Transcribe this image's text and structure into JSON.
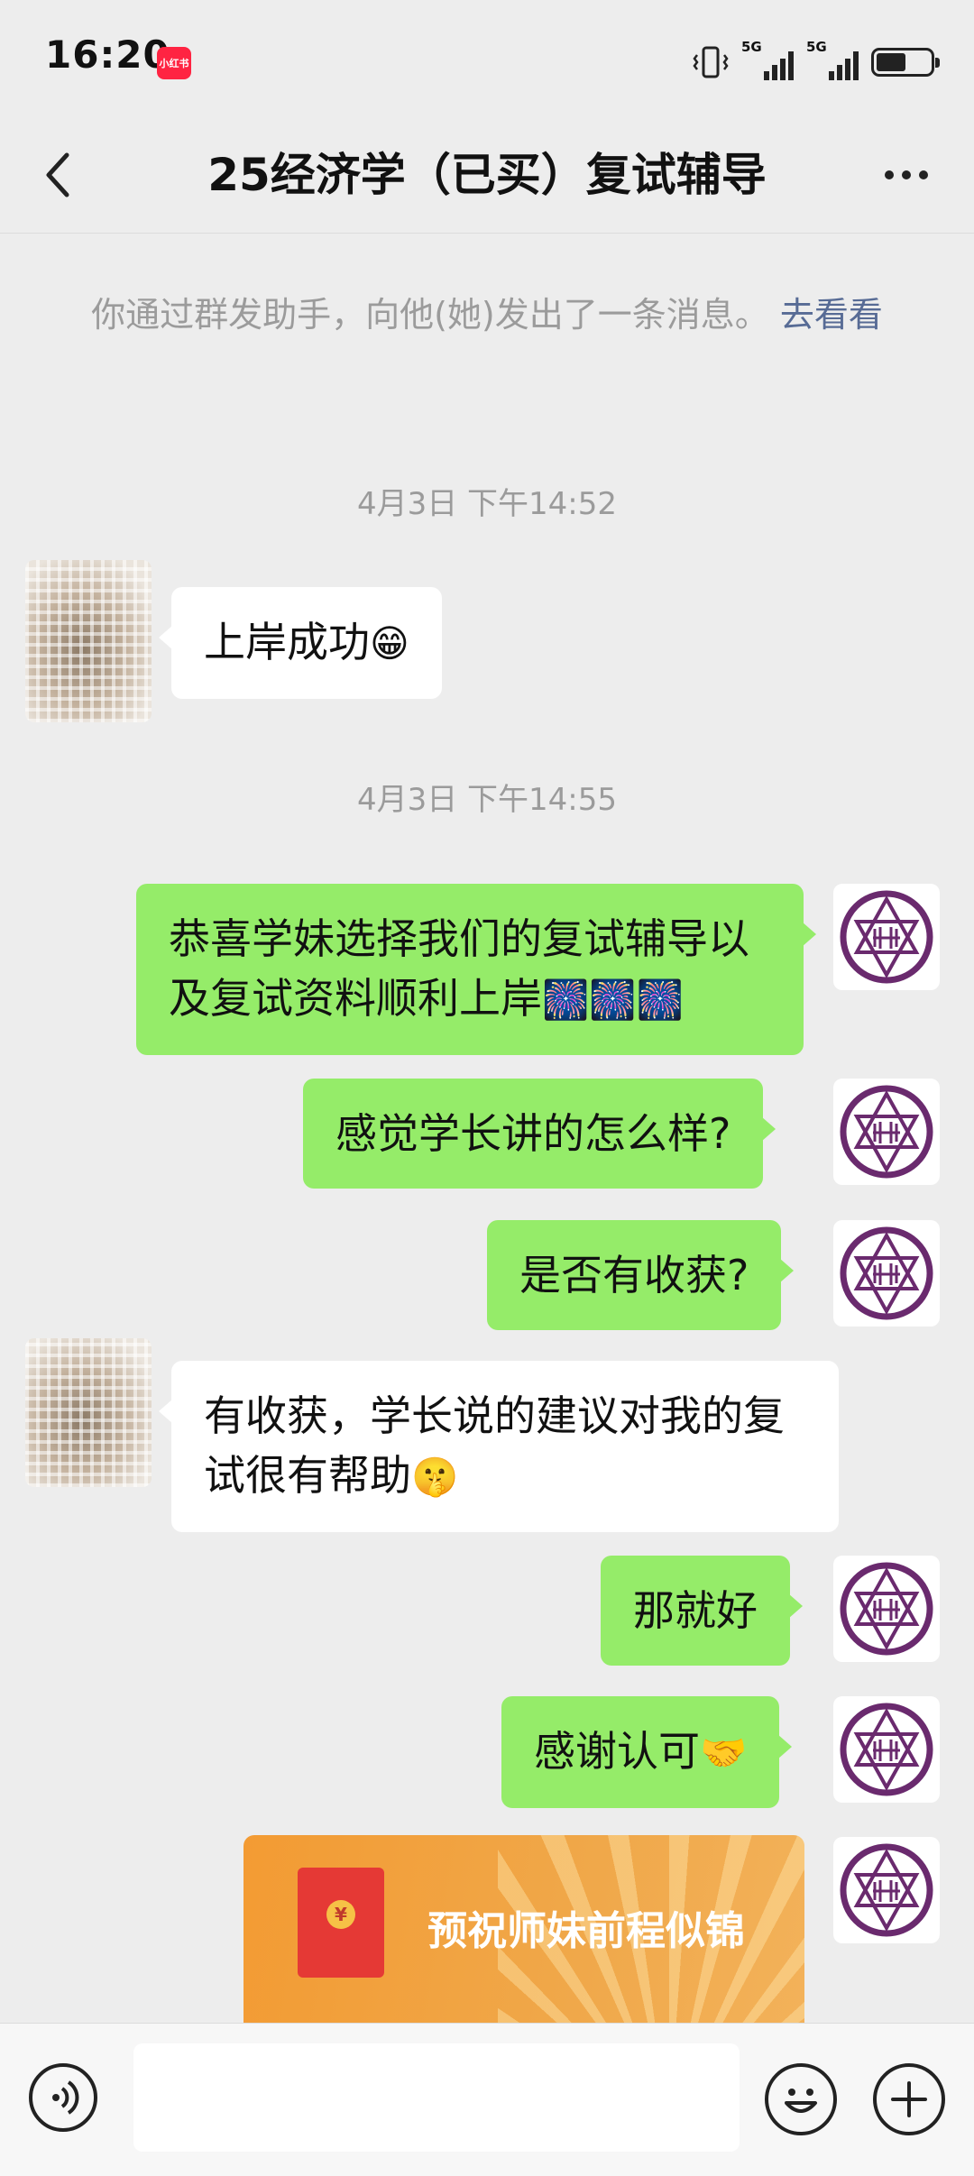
{
  "status_bar": {
    "time": "16:20",
    "app_badge": "小红书",
    "signal_1": "5G",
    "signal_2": "5G"
  },
  "nav": {
    "title": "25经济学（已买）复试辅导",
    "back_icon": "chevron-left-icon",
    "more_icon": "more-dots-icon"
  },
  "messages": {
    "system_notice": "你通过群发助手，向他(她)发出了一条消息。",
    "system_link": "去看看",
    "timestamp_1": "4月3日 下午14:52",
    "timestamp_2": "4月3日 下午14:55",
    "msg_1_text": "上岸成功",
    "msg_1_emoji": "😁",
    "msg_2_text": "恭喜学妹选择我们的复试辅导以及复试资料顺利上岸",
    "msg_2_emoji": "🎆🎆🎆",
    "msg_3_text": "感觉学长讲的怎么样?",
    "msg_4_text": "是否有收获?",
    "msg_5_text": "有收获，学长说的建议对我的复试很有帮助",
    "msg_5_emoji": "🤫",
    "msg_6_text": "那就好",
    "msg_7_text": "感谢认可",
    "msg_7_emoji": "🤝",
    "red_packet_text": "预祝师妹前程似锦",
    "red_packet_coin": "¥"
  },
  "input_bar": {
    "value": "",
    "voice_icon": "voice-icon",
    "emoji_icon": "emoji-icon",
    "plus_icon": "plus-icon"
  },
  "colors": {
    "background": "#ededed",
    "bubble_self": "#95ec69",
    "bubble_other": "#ffffff",
    "link": "#576b95",
    "system_text": "#9b9b9b",
    "red_packet": "#f39b33"
  }
}
